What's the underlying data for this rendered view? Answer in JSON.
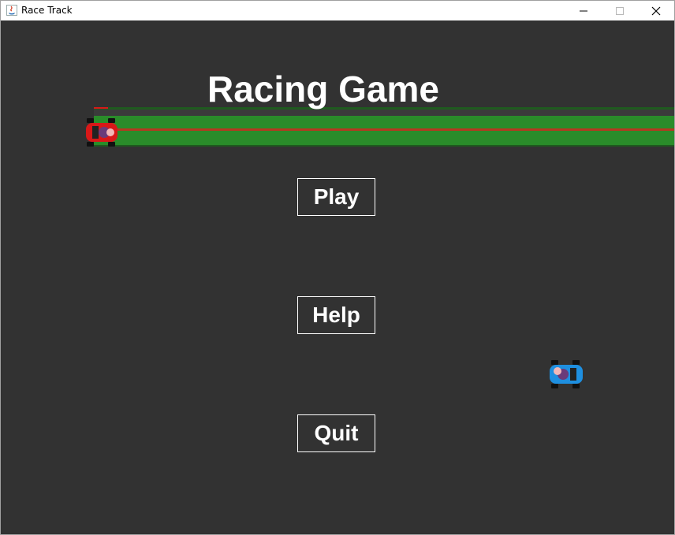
{
  "window": {
    "title": "Race Track"
  },
  "title_controls": [
    "minimize",
    "maximize",
    "close"
  ],
  "game": {
    "title": "Racing Game",
    "buttons": {
      "play": "Play",
      "help": "Help",
      "quit": "Quit"
    }
  },
  "colors": {
    "background": "#323232",
    "text": "#ffffff",
    "track_green": "#2a8c2a",
    "red_kart": "#d81818",
    "blue_kart": "#1e8fe0"
  }
}
